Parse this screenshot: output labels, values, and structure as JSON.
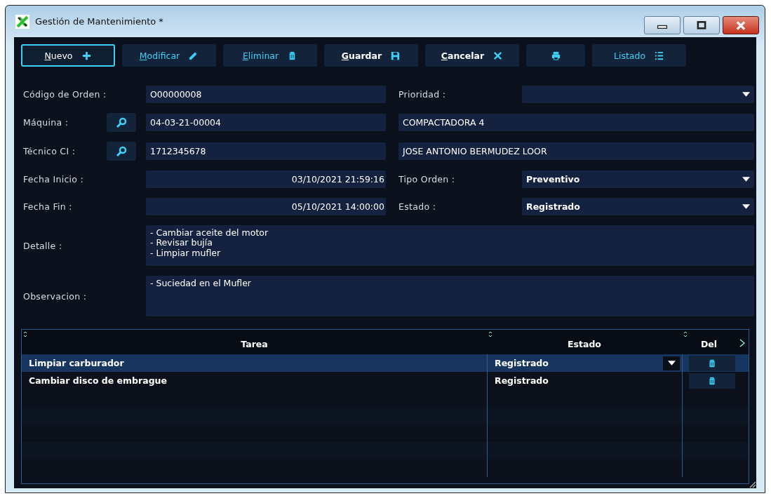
{
  "window": {
    "title": "Gestión de Mantenimiento *"
  },
  "toolbar": [
    {
      "label": "Nuevo",
      "kind": "plus",
      "focused": true,
      "mnemonic": true
    },
    {
      "label": "Modificar",
      "kind": "pencil",
      "focused": false,
      "mnemonic": true
    },
    {
      "label": "Eliminar",
      "kind": "trash",
      "focused": false,
      "mnemonic": true
    },
    {
      "label": "Guardar",
      "kind": "save",
      "focused": false,
      "mnemonic": true
    },
    {
      "label": "Cancelar",
      "kind": "close",
      "focused": false,
      "mnemonic": true
    },
    {
      "kind": "printer",
      "focused": false
    },
    {
      "label": "Listado",
      "kind": "list",
      "focused": false,
      "mnemonic": false
    }
  ],
  "form": [
    {
      "label": "Código de Orden :",
      "kind": "text",
      "value": "O00000008",
      "right": {
        "kind": "dropdown",
        "label": "Prioridad :"
      }
    },
    {
      "label": "Máquina :",
      "kind": "lookup",
      "value": "04-03-21-00004",
      "right": {
        "kind": "text",
        "value": "COMPACTADORA 4"
      }
    },
    {
      "label": "Técnico CI :",
      "kind": "lookup",
      "value": "1712345678",
      "right": {
        "kind": "text",
        "value": "JOSE ANTONIO BERMUDEZ LOOR"
      }
    },
    {
      "label": "Fecha Inicio :",
      "kind": "date",
      "value": "03/10/2021 21:59:16",
      "right": {
        "kind": "dropdown",
        "label": "Tipo Orden :",
        "value": "Preventivo"
      }
    },
    {
      "label": "Fecha Fin :",
      "kind": "date",
      "value": "05/10/2021 14:00:00",
      "right": {
        "kind": "dropdown",
        "label": "Estado :",
        "value": "Registrado"
      }
    },
    {
      "label": "Detalle :",
      "kind": "memo",
      "value": "- Cambiar aceite del motor\n- Revisar bujía\n- Limpiar mufler"
    },
    {
      "label": "Observacion :",
      "kind": "memo",
      "value": "- Suciedad en el Mufler"
    }
  ],
  "table": {
    "columns": [
      "Tarea",
      "Estado",
      "Del"
    ],
    "rows": [
      {
        "tarea": "Limpiar carburador",
        "estado": "Registrado",
        "selected": true
      },
      {
        "tarea": "Cambiar disco de embrague",
        "estado": "Registrado",
        "selected": false
      }
    ]
  }
}
